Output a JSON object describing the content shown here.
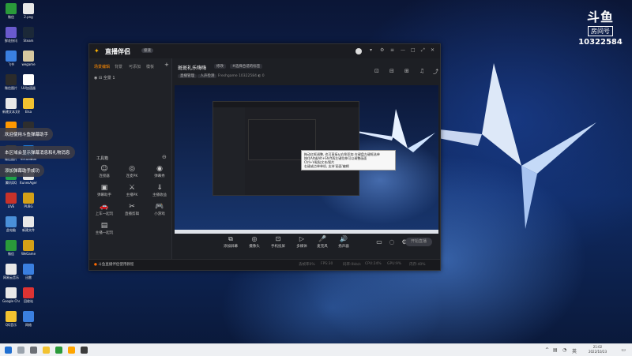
{
  "desktop": {
    "badge": {
      "logo": "斗鱼",
      "room_label": "房间号",
      "room_number": "10322584"
    },
    "icons": [
      {
        "label": "微信",
        "color": "#2a9a3a"
      },
      {
        "label": "鲜花快讯",
        "color": "#6a5acd"
      },
      {
        "label": "飞书",
        "color": "#3a7fe0"
      },
      {
        "label": "微信图片",
        "color": "#2b2b2b"
      },
      {
        "label": "新建文本文档",
        "color": "#e8e8e8"
      },
      {
        "label": "斗鱼直播伴侣",
        "color": "#ff9800"
      },
      {
        "label": "微信图片",
        "color": "#3b3b3b"
      },
      {
        "label": "腾讯QQ",
        "color": "#1fa34a"
      },
      {
        "label": "LIVE",
        "color": "#c7322a"
      },
      {
        "label": "此电脑",
        "color": "#4a90d9"
      },
      {
        "label": "微信",
        "color": "#2a9a3a"
      },
      {
        "label": "网易云音乐",
        "color": "#e8e8e8"
      },
      {
        "label": "Google Chrome",
        "color": "#e8e8e8"
      },
      {
        "label": "QQ音乐",
        "color": "#f2c230"
      },
      {
        "label": "2.png",
        "color": "#e8e8e8"
      },
      {
        "label": "Steam",
        "color": "#1b2838"
      },
      {
        "label": "wegame",
        "color": "#d7c8a0"
      },
      {
        "label": "UU加速器",
        "color": "#ffffff"
      },
      {
        "label": "Elsa",
        "color": "#f2c230"
      },
      {
        "label": "OBS",
        "color": "#2e2e2e"
      },
      {
        "label": "VirtualBox",
        "color": "#1e7bd6"
      },
      {
        "label": "ItunesAgent",
        "color": "#e8e8e8"
      },
      {
        "label": "PUBG",
        "color": "#d4a017"
      },
      {
        "label": "新建文件",
        "color": "#e8e8e8"
      },
      {
        "label": "WeGame",
        "color": "#d4a017"
      },
      {
        "label": "迅雷",
        "color": "#3a7fe0"
      },
      {
        "label": "回收站",
        "color": "#d33"
      },
      {
        "label": "网络",
        "color": "#3a7fe0"
      }
    ]
  },
  "notifications": [
    {
      "text": "欢迎使用斗鱼弹幕助手"
    },
    {
      "text": "本区域会显示弹幕消息和礼物消息"
    },
    {
      "text": "添加弹幕助手成功"
    }
  ],
  "app": {
    "name": "直播伴侣",
    "version_badge": "极速",
    "left_tabs": [
      "场景编辑",
      "背景",
      "可添加",
      "模板"
    ],
    "scene": "全景 1",
    "tools_title": "工具箱",
    "tools": [
      {
        "icon": "☺",
        "label": "连接器"
      },
      {
        "icon": "◎",
        "label": "连麦PK"
      },
      {
        "icon": "◉",
        "label": "弹幕秀"
      },
      {
        "icon": "▣",
        "label": "弹幕助手"
      },
      {
        "icon": "⚔",
        "label": "主播PK"
      },
      {
        "icon": "⇓",
        "label": "主播收益"
      },
      {
        "icon": "🚗",
        "label": "上车一起玩"
      },
      {
        "icon": "✂",
        "label": "直播剪辑"
      },
      {
        "icon": "🎮",
        "label": "小游戏"
      },
      {
        "icon": "▤",
        "label": "主播一起玩"
      }
    ],
    "stream_title": "斑斑礼乐嗨嗨",
    "stream_tag": "修改",
    "stream_category": "#选择合适的标签",
    "stream_row2": [
      "直播管理",
      "人声检测",
      "Freshgame",
      "10322584"
    ],
    "viewer_count": "0",
    "tooltip_lines": [
      "拖动红框调整, 也可直接从右侧添加 在键盘左键框选单",
      "按住Alt或Alt+Shift再左键拉伸可以调整画面",
      "Ctrl+V粘贴文本/图片",
      "右键或点单单机, 支持'画面'编辑"
    ],
    "controls": [
      {
        "icon": "⧉",
        "label": "添加屏幕"
      },
      {
        "icon": "◎",
        "label": "摄像头"
      },
      {
        "icon": "⊡",
        "label": "手机投屏"
      },
      {
        "icon": "▷",
        "label": "多媒体"
      },
      {
        "icon": "🎤",
        "label": "麦克风"
      },
      {
        "icon": "🔊",
        "label": "扬声器"
      }
    ],
    "start_button": "开始直播",
    "status_left": "斗鱼直播伴侣使用教程",
    "status_items": [
      "丢帧率0%",
      "FPS:30",
      "码率:0kb/s",
      "CPU:24%",
      "GPU:9%",
      "内存:40%"
    ]
  },
  "taskbar": {
    "time": "21:02",
    "date": "2022/10/23"
  }
}
